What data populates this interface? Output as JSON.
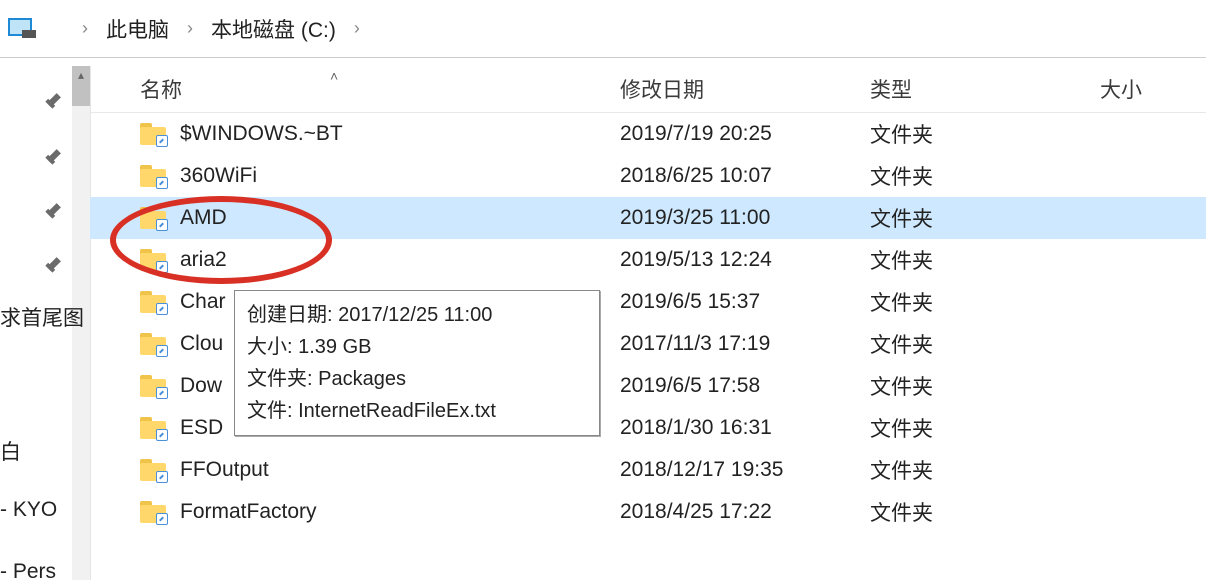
{
  "breadcrumb": {
    "root": "此电脑",
    "drive": "本地磁盘 (C:)"
  },
  "quick_access": {
    "item1": "求首尾图",
    "item2": "白",
    "item3": "- KYO",
    "item4": "- Pers"
  },
  "columns": {
    "name": "名称",
    "date": "修改日期",
    "type": "类型",
    "size": "大小"
  },
  "rows": [
    {
      "name": "$WINDOWS.~BT",
      "date": "2019/7/19 20:25",
      "type": "文件夹"
    },
    {
      "name": "360WiFi",
      "date": "2018/6/25 10:07",
      "type": "文件夹"
    },
    {
      "name": "AMD",
      "date": "2019/3/25 11:00",
      "type": "文件夹"
    },
    {
      "name": "aria2",
      "date": "2019/5/13 12:24",
      "type": "文件夹"
    },
    {
      "name": "Char",
      "date": "2019/6/5 15:37",
      "type": "文件夹"
    },
    {
      "name": "Clou",
      "date": "2017/11/3 17:19",
      "type": "文件夹"
    },
    {
      "name": "Dow",
      "date": "2019/6/5 17:58",
      "type": "文件夹"
    },
    {
      "name": "ESD",
      "date": "2018/1/30 16:31",
      "type": "文件夹"
    },
    {
      "name": "FFOutput",
      "date": "2018/12/17 19:35",
      "type": "文件夹"
    },
    {
      "name": "FormatFactory",
      "date": "2018/4/25 17:22",
      "type": "文件夹"
    }
  ],
  "selected_index": 2,
  "tooltip": {
    "l1": "创建日期: 2017/12/25 11:00",
    "l2": "大小: 1.39 GB",
    "l3": "文件夹: Packages",
    "l4": "文件: InternetReadFileEx.txt"
  }
}
